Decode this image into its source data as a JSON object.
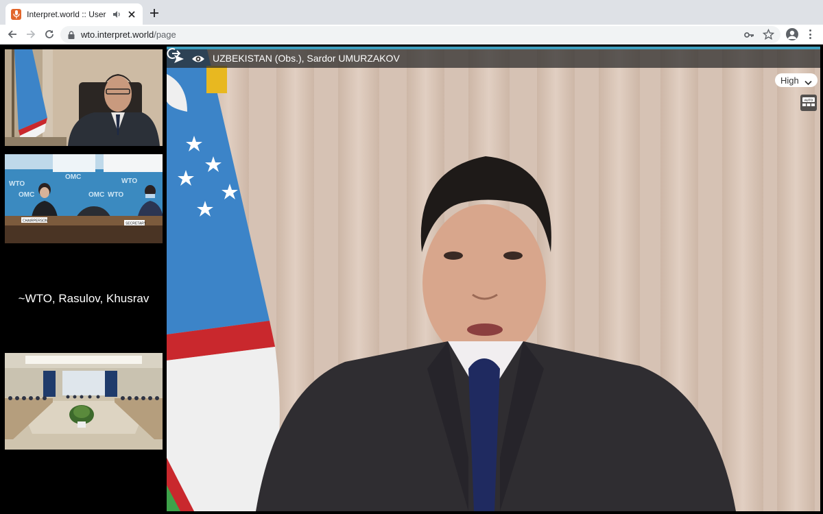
{
  "browser": {
    "tab_title": "Interpret.world :: User Inter",
    "url_domain": "wto.interpret.world",
    "url_path": "/page"
  },
  "thumbnails": {
    "participant_name": "~WTO, Rasulov, Khusrav",
    "room_signs": {
      "chairperson": "CHAIRPERSON",
      "secretary": "SECRETARY",
      "wto": "WTO",
      "omc": "OMC"
    }
  },
  "main_video": {
    "speaker_name": "UZBEKISTAN (Obs.), Sardor UMURZAKOV",
    "quality_selected": "High",
    "auto_label": "AUTO"
  },
  "colors": {
    "accent": "#3f9fbf",
    "favicon": "#e2662b",
    "uz_flag_blue": "#3c84c8",
    "uz_flag_green": "#3ea24a",
    "uz_flag_red": "#c9282d"
  }
}
